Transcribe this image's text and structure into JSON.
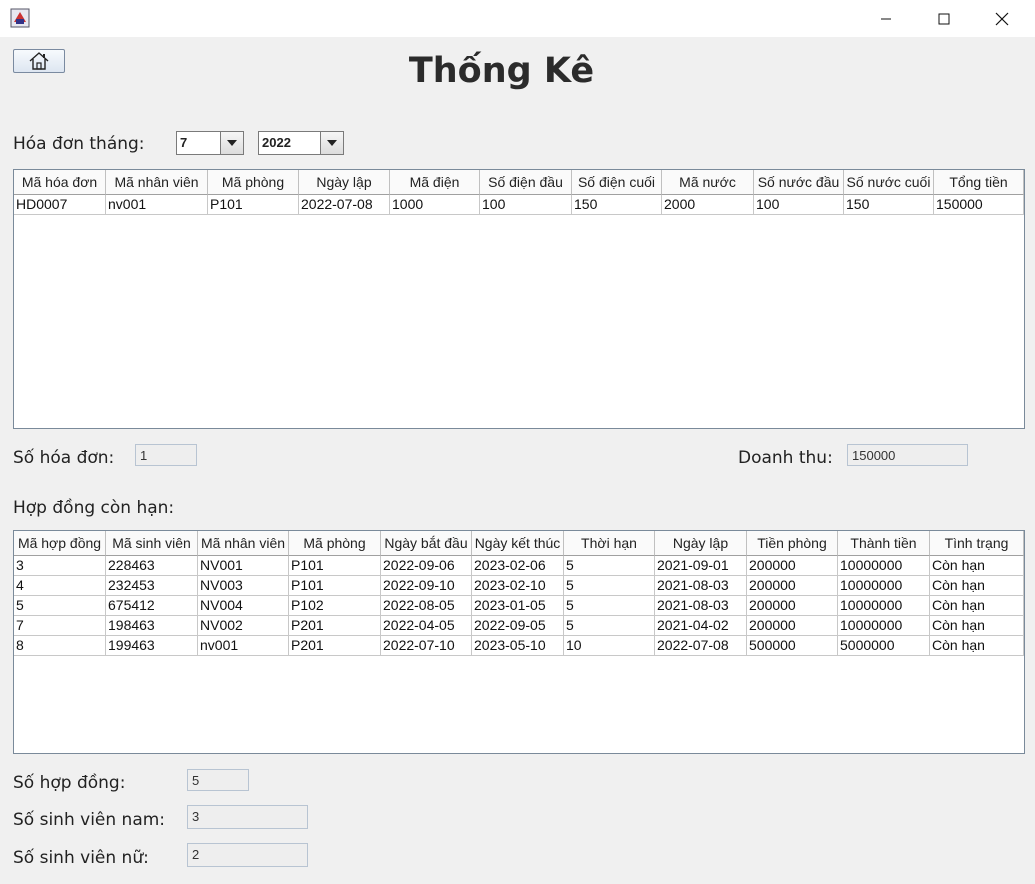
{
  "window": {
    "min_icon": "minimize-icon",
    "max_icon": "maximize-icon",
    "close_icon": "close-icon"
  },
  "header": {
    "title": "Thống Kê",
    "home_icon": "home-icon"
  },
  "invoice_filter": {
    "label": "Hóa đơn tháng:",
    "month": "7",
    "year": "2022"
  },
  "invoices": {
    "columns": [
      "Mã hóa đơn",
      "Mã nhân viên",
      "Mã phòng",
      "Ngày lập",
      "Mã điện",
      "Số điện đầu",
      "Số điện cuối",
      "Mã nước",
      "Số nước đầu",
      "Số nước cuối",
      "Tổng tiền"
    ],
    "rows": [
      [
        "HD0007",
        "nv001",
        "P101",
        "2022-07-08",
        "1000",
        "100",
        "150",
        "2000",
        "100",
        "150",
        "150000"
      ]
    ]
  },
  "invoice_summary": {
    "count_label": "Số hóa đơn:",
    "count": "1",
    "revenue_label": "Doanh thu:",
    "revenue": "150000"
  },
  "contracts_label": "Hợp đồng còn hạn:",
  "contracts": {
    "columns": [
      "Mã hợp đồng",
      "Mã sinh viên",
      "Mã nhân viên",
      "Mã phòng",
      "Ngày bắt đầu",
      "Ngày kết thúc",
      "Thời hạn",
      "Ngày lập",
      "Tiền phòng",
      "Thành tiền",
      "Tình trạng"
    ],
    "rows": [
      [
        "3",
        "228463",
        "NV001",
        "P101",
        "2022-09-06",
        "2023-02-06",
        "5",
        "2021-09-01",
        "200000",
        "10000000",
        "Còn hạn"
      ],
      [
        "4",
        "232453",
        "NV003",
        "P101",
        "2022-09-10",
        "2023-02-10",
        "5",
        "2021-08-03",
        "200000",
        "10000000",
        "Còn hạn"
      ],
      [
        "5",
        "675412",
        "NV004",
        "P102",
        "2022-08-05",
        "2023-01-05",
        "5",
        "2021-08-03",
        "200000",
        "10000000",
        "Còn hạn"
      ],
      [
        "7",
        "198463",
        "NV002",
        "P201",
        "2022-04-05",
        "2022-09-05",
        "5",
        "2021-04-02",
        "200000",
        "10000000",
        "Còn hạn"
      ],
      [
        "8",
        "199463",
        "nv001",
        "P201",
        "2022-07-10",
        "2023-05-10",
        "10",
        "2022-07-08",
        "500000",
        "5000000",
        "Còn hạn"
      ]
    ]
  },
  "contract_summary": {
    "count_label": "Số hợp đồng:",
    "count": "5",
    "male_label": "Số sinh viên nam:",
    "male": "3",
    "female_label": "Số sinh viên nữ:",
    "female": "2"
  }
}
